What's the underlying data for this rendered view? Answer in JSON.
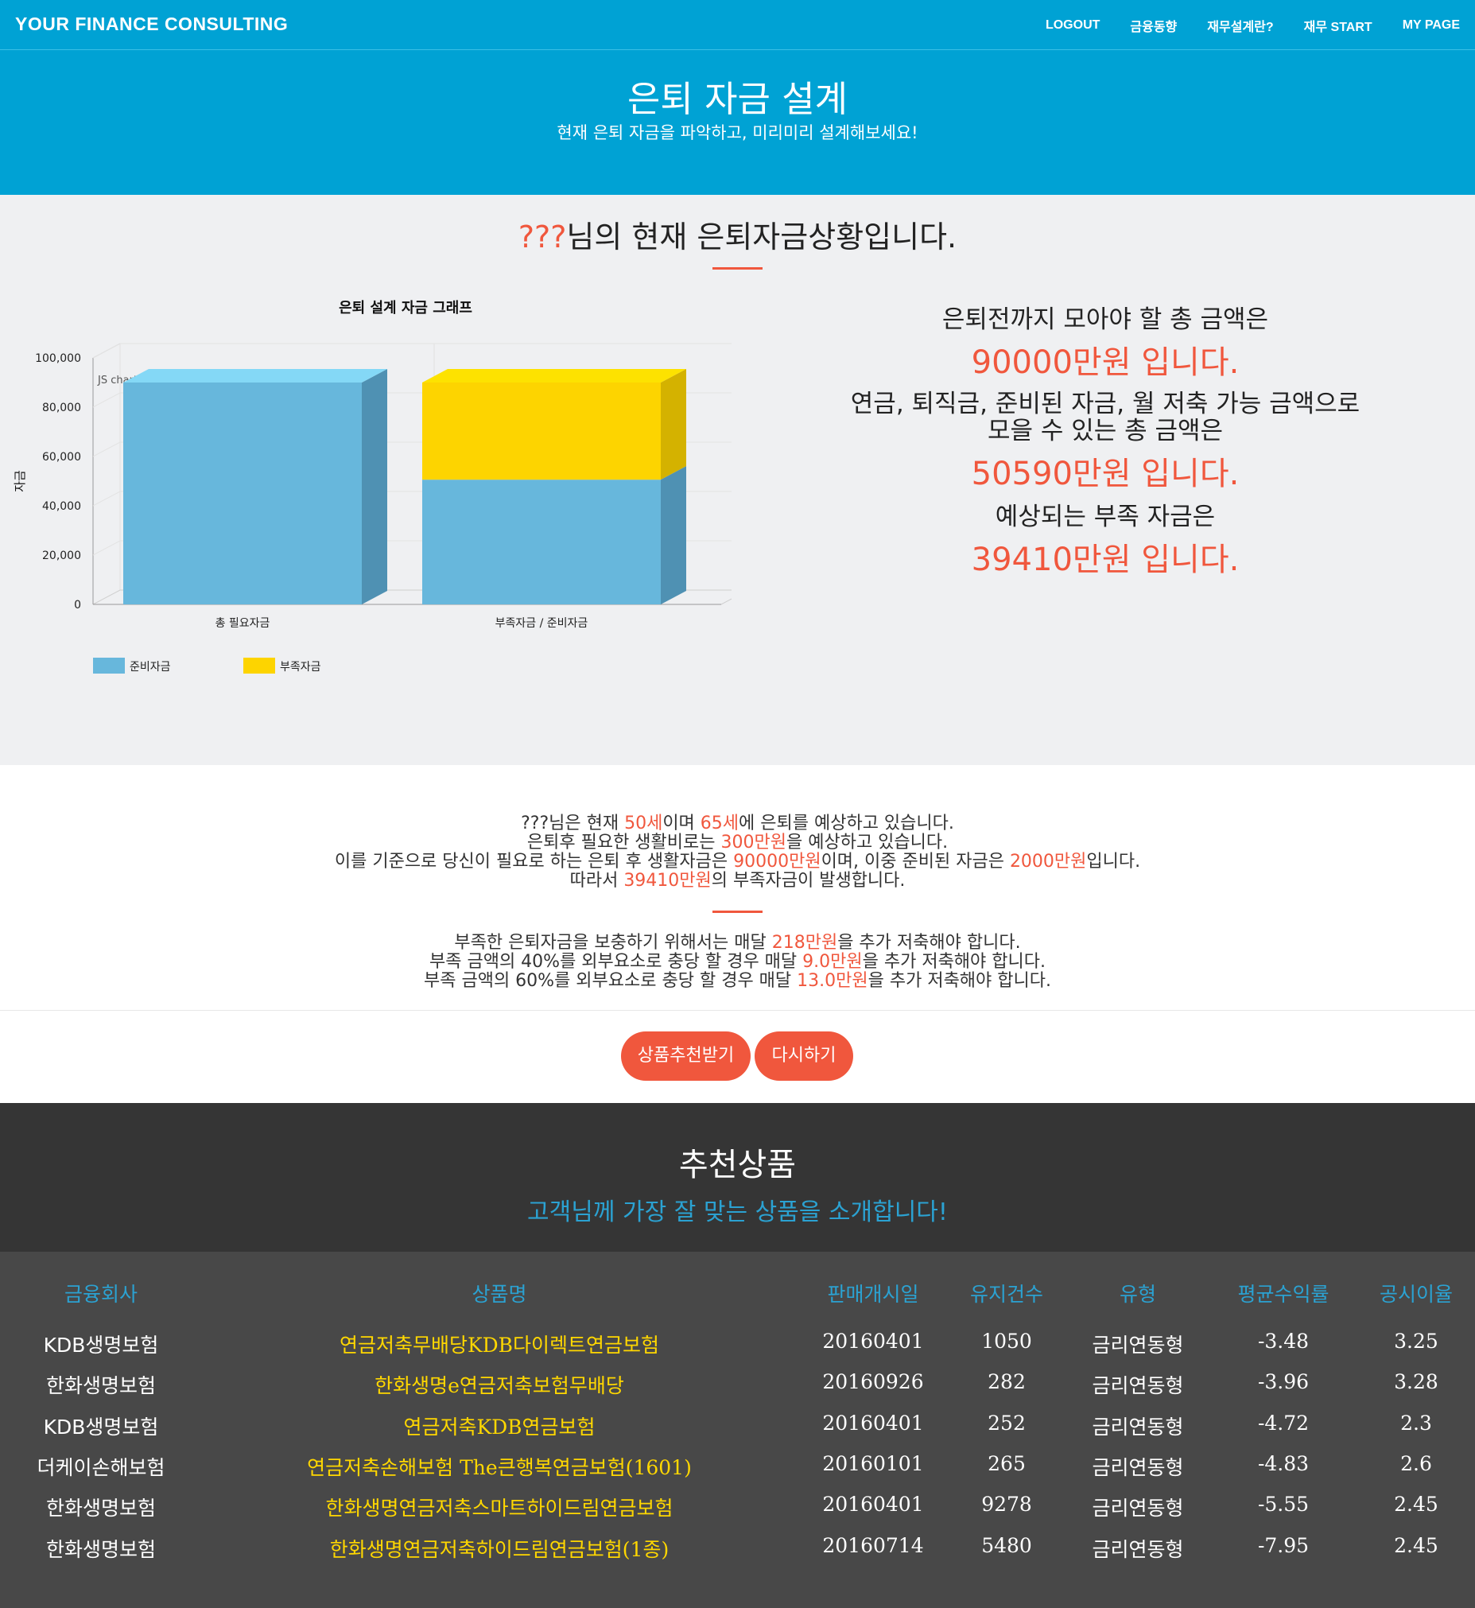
{
  "nav": {
    "brand": "YOUR FINANCE CONSULTING",
    "items": [
      "LOGOUT",
      "금융동향",
      "재무설계란?",
      "재무 START",
      "MY PAGE"
    ]
  },
  "hero": {
    "title": "은퇴 자금 설계",
    "subtitle": "현재 은퇴 자금을 파악하고, 미리미리 설계해보세요!"
  },
  "status": {
    "name": "???",
    "heading_suffix": "님의 현재 은퇴자금상황입니다."
  },
  "summary": {
    "line1": "은퇴전까지 모아야 할 총 금액은",
    "total_needed": "90000만원 입니다.",
    "line2a": "연금, 퇴직금, 준비된 자금, 월 저축 가능 금액으로",
    "line2b": "모을 수 있는 총 금액은",
    "total_collectable": "50590만원 입니다.",
    "line3": "예상되는 부족 자금은",
    "shortfall": "39410만원 입니다."
  },
  "chart_data": {
    "type": "bar",
    "stacked": true,
    "title": "은퇴 설계 자금 그래프",
    "ylabel": "자금",
    "xlabel": "",
    "credit": "JS chart by amCharts",
    "categories": [
      "총 필요자금",
      "부족자금 / 준비자금"
    ],
    "series": [
      {
        "name": "준비자금",
        "color": "#67b7dc",
        "values": [
          90000,
          50590
        ]
      },
      {
        "name": "부족자금",
        "color": "#fdd400",
        "values": [
          0,
          39410
        ]
      }
    ],
    "ylim": [
      0,
      100000
    ],
    "yticks": [
      "100,000",
      "80,000",
      "60,000",
      "40,000",
      "20,000",
      "0"
    ],
    "grid": true,
    "legend": "bottom-left"
  },
  "detail": {
    "p1_l1": [
      "???님은 현재 ",
      "50세",
      "이며 ",
      "65세",
      "에 은퇴를 예상하고 있습니다."
    ],
    "p1_l2": [
      "은퇴후 필요한 생활비로는 ",
      "300만원",
      "을 예상하고 있습니다."
    ],
    "p1_l3": [
      "이를 기준으로 당신이 필요로 하는 은퇴 후 생활자금은 ",
      "90000만원",
      "이며, 이중 준비된 자금은 ",
      "2000만원",
      "입니다."
    ],
    "p1_l4": [
      "따라서 ",
      "39410만원",
      "의 부족자금이 발생합니다."
    ],
    "p2_l1": [
      "부족한 은퇴자금을 보충하기 위해서는 매달 ",
      "218만원",
      "을 추가 저축해야 합니다."
    ],
    "p2_l2": [
      "부족 금액의 40%를 외부요소로 충당 할 경우 매달 ",
      "9.0만원",
      "을 추가 저축해야 합니다."
    ],
    "p2_l3": [
      "부족 금액의 60%를 외부요소로 충당 할 경우 매달 ",
      "13.0만원",
      "을 추가 저축해야 합니다."
    ]
  },
  "buttons": {
    "recommend": "상품추천받기",
    "retry": "다시하기"
  },
  "recommend": {
    "title": "추천상품",
    "subtitle": "고객님께 가장 잘 맞는 상품을 소개합니다!",
    "headers": [
      "금융회사",
      "상품명",
      "판매개시일",
      "유지건수",
      "유형",
      "평균수익률",
      "공시이율"
    ],
    "rows": [
      [
        "KDB생명보험",
        "연금저축무배당KDB다이렉트연금보험",
        "20160401",
        "1050",
        "금리연동형",
        "-3.48",
        "3.25"
      ],
      [
        "한화생명보험",
        "한화생명e연금저축보험무배당",
        "20160926",
        "282",
        "금리연동형",
        "-3.96",
        "3.28"
      ],
      [
        "KDB생명보험",
        "연금저축KDB연금보험",
        "20160401",
        "252",
        "금리연동형",
        "-4.72",
        "2.3"
      ],
      [
        "더케이손해보험",
        "연금저축손해보험 The큰행복연금보험(1601)",
        "20160101",
        "265",
        "금리연동형",
        "-4.83",
        "2.6"
      ],
      [
        "한화생명보험",
        "한화생명연금저축스마트하이드림연금보험",
        "20160401",
        "9278",
        "금리연동형",
        "-5.55",
        "2.45"
      ],
      [
        "한화생명보험",
        "한화생명연금저축하이드림연금보험(1종)",
        "20160714",
        "5480",
        "금리연동형",
        "-7.95",
        "2.45"
      ]
    ]
  }
}
